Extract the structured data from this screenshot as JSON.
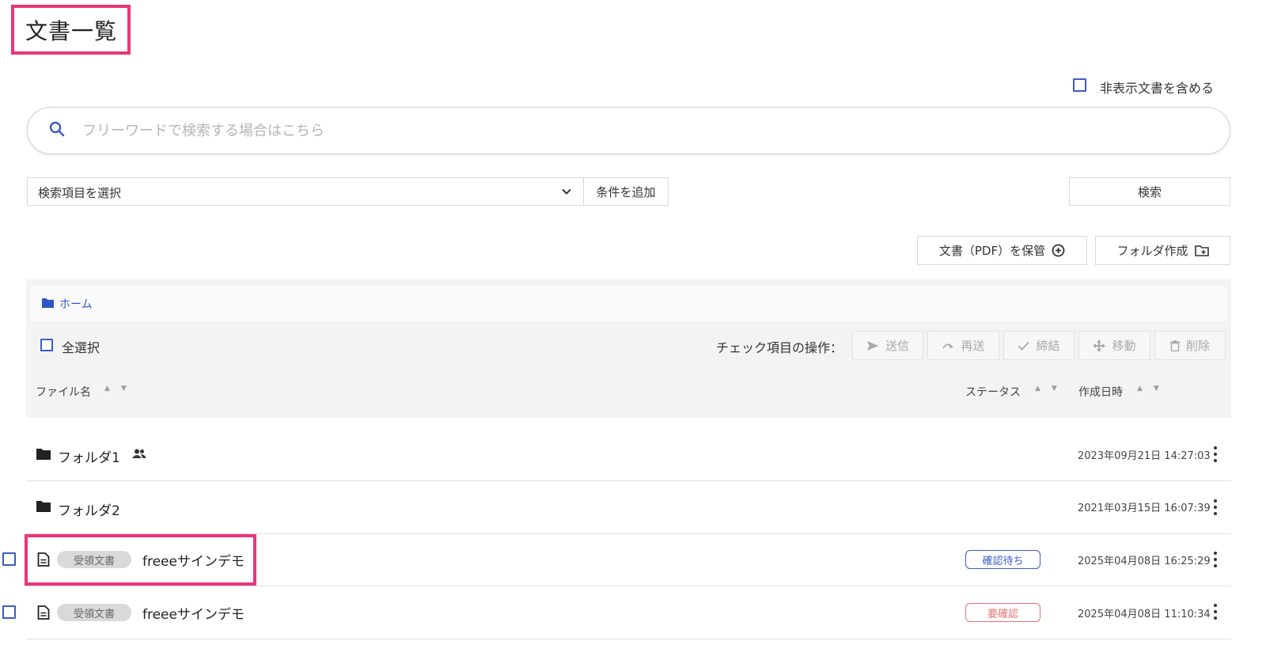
{
  "page": {
    "title": "文書一覧"
  },
  "options": {
    "include_hidden_label": "非表示文書を含める"
  },
  "search": {
    "placeholder": "フリーワードで検索する場合はこちら"
  },
  "conditions": {
    "select_placeholder": "検索項目を選択",
    "add_condition_label": "条件を追加",
    "search_button_label": "検索"
  },
  "actions": {
    "store_pdf_label": "文書（PDF）を保管",
    "create_folder_label": "フォルダ作成"
  },
  "breadcrumb": {
    "home_label": "ホーム"
  },
  "bulk": {
    "select_all_label": "全選択",
    "operations_label": "チェック項目の操作：",
    "send_label": "送信",
    "resend_label": "再送",
    "conclude_label": "締結",
    "move_label": "移動",
    "delete_label": "削除"
  },
  "columns": {
    "file_name": "ファイル名",
    "status": "ステータス",
    "created_at": "作成日時"
  },
  "rows": [
    {
      "type": "folder",
      "name": "フォルダ1",
      "shared": true,
      "date": "2023年09月21日 14:27:03"
    },
    {
      "type": "folder",
      "name": "フォルダ2",
      "shared": false,
      "date": "2021年03月15日 16:07:39"
    },
    {
      "type": "document",
      "tag": "受領文書",
      "name": "freeeサインデモ",
      "status": "確認待ち",
      "status_color": "#3b5cc6",
      "date": "2025年04月08日 16:25:29"
    },
    {
      "type": "document",
      "tag": "受領文書",
      "name": "freeeサインデモ",
      "status": "要確認",
      "status_color": "#e57373",
      "date": "2025年04月08日 11:10:34"
    }
  ],
  "colors": {
    "highlight": "#e8357a",
    "accent": "#3b5cc6",
    "link": "#2f55c4"
  }
}
